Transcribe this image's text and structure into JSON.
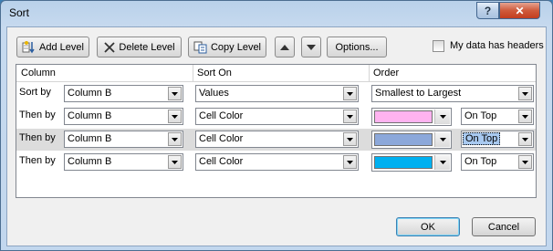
{
  "window": {
    "title": "Sort",
    "help_glyph": "?",
    "close_glyph": "✕"
  },
  "toolbar": {
    "add_level": "Add Level",
    "delete_level": "Delete Level",
    "copy_level": "Copy Level",
    "options": "Options...",
    "move_up_icon": "triangle-up",
    "move_down_icon": "triangle-down"
  },
  "headers_checkbox": {
    "label": "My data has headers",
    "checked": false
  },
  "columns": {
    "column": "Column",
    "sort_on": "Sort On",
    "order": "Order"
  },
  "rows": [
    {
      "label": "Sort by",
      "column": "Column B",
      "sort_on": "Values",
      "order": "Smallest to Largest"
    },
    {
      "label": "Then by",
      "column": "Column B",
      "sort_on": "Cell Color",
      "color": "#ffb3f0",
      "position": "On Top"
    },
    {
      "label": "Then by",
      "column": "Column B",
      "sort_on": "Cell Color",
      "color": "#8ca8da",
      "position": "On Top"
    },
    {
      "label": "Then by",
      "column": "Column B",
      "sort_on": "Cell Color",
      "color": "#00b0f0",
      "position": "On Top"
    }
  ],
  "buttons": {
    "ok": "OK",
    "cancel": "Cancel"
  }
}
